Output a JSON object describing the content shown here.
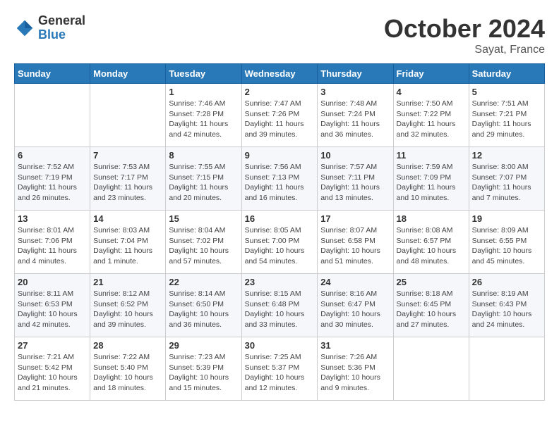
{
  "logo": {
    "general": "General",
    "blue": "Blue"
  },
  "title": "October 2024",
  "location": "Sayat, France",
  "weekdays": [
    "Sunday",
    "Monday",
    "Tuesday",
    "Wednesday",
    "Thursday",
    "Friday",
    "Saturday"
  ],
  "weeks": [
    [
      {
        "day": "",
        "sunrise": "",
        "sunset": "",
        "daylight": ""
      },
      {
        "day": "",
        "sunrise": "",
        "sunset": "",
        "daylight": ""
      },
      {
        "day": "1",
        "sunrise": "Sunrise: 7:46 AM",
        "sunset": "Sunset: 7:28 PM",
        "daylight": "Daylight: 11 hours and 42 minutes."
      },
      {
        "day": "2",
        "sunrise": "Sunrise: 7:47 AM",
        "sunset": "Sunset: 7:26 PM",
        "daylight": "Daylight: 11 hours and 39 minutes."
      },
      {
        "day": "3",
        "sunrise": "Sunrise: 7:48 AM",
        "sunset": "Sunset: 7:24 PM",
        "daylight": "Daylight: 11 hours and 36 minutes."
      },
      {
        "day": "4",
        "sunrise": "Sunrise: 7:50 AM",
        "sunset": "Sunset: 7:22 PM",
        "daylight": "Daylight: 11 hours and 32 minutes."
      },
      {
        "day": "5",
        "sunrise": "Sunrise: 7:51 AM",
        "sunset": "Sunset: 7:21 PM",
        "daylight": "Daylight: 11 hours and 29 minutes."
      }
    ],
    [
      {
        "day": "6",
        "sunrise": "Sunrise: 7:52 AM",
        "sunset": "Sunset: 7:19 PM",
        "daylight": "Daylight: 11 hours and 26 minutes."
      },
      {
        "day": "7",
        "sunrise": "Sunrise: 7:53 AM",
        "sunset": "Sunset: 7:17 PM",
        "daylight": "Daylight: 11 hours and 23 minutes."
      },
      {
        "day": "8",
        "sunrise": "Sunrise: 7:55 AM",
        "sunset": "Sunset: 7:15 PM",
        "daylight": "Daylight: 11 hours and 20 minutes."
      },
      {
        "day": "9",
        "sunrise": "Sunrise: 7:56 AM",
        "sunset": "Sunset: 7:13 PM",
        "daylight": "Daylight: 11 hours and 16 minutes."
      },
      {
        "day": "10",
        "sunrise": "Sunrise: 7:57 AM",
        "sunset": "Sunset: 7:11 PM",
        "daylight": "Daylight: 11 hours and 13 minutes."
      },
      {
        "day": "11",
        "sunrise": "Sunrise: 7:59 AM",
        "sunset": "Sunset: 7:09 PM",
        "daylight": "Daylight: 11 hours and 10 minutes."
      },
      {
        "day": "12",
        "sunrise": "Sunrise: 8:00 AM",
        "sunset": "Sunset: 7:07 PM",
        "daylight": "Daylight: 11 hours and 7 minutes."
      }
    ],
    [
      {
        "day": "13",
        "sunrise": "Sunrise: 8:01 AM",
        "sunset": "Sunset: 7:06 PM",
        "daylight": "Daylight: 11 hours and 4 minutes."
      },
      {
        "day": "14",
        "sunrise": "Sunrise: 8:03 AM",
        "sunset": "Sunset: 7:04 PM",
        "daylight": "Daylight: 11 hours and 1 minute."
      },
      {
        "day": "15",
        "sunrise": "Sunrise: 8:04 AM",
        "sunset": "Sunset: 7:02 PM",
        "daylight": "Daylight: 10 hours and 57 minutes."
      },
      {
        "day": "16",
        "sunrise": "Sunrise: 8:05 AM",
        "sunset": "Sunset: 7:00 PM",
        "daylight": "Daylight: 10 hours and 54 minutes."
      },
      {
        "day": "17",
        "sunrise": "Sunrise: 8:07 AM",
        "sunset": "Sunset: 6:58 PM",
        "daylight": "Daylight: 10 hours and 51 minutes."
      },
      {
        "day": "18",
        "sunrise": "Sunrise: 8:08 AM",
        "sunset": "Sunset: 6:57 PM",
        "daylight": "Daylight: 10 hours and 48 minutes."
      },
      {
        "day": "19",
        "sunrise": "Sunrise: 8:09 AM",
        "sunset": "Sunset: 6:55 PM",
        "daylight": "Daylight: 10 hours and 45 minutes."
      }
    ],
    [
      {
        "day": "20",
        "sunrise": "Sunrise: 8:11 AM",
        "sunset": "Sunset: 6:53 PM",
        "daylight": "Daylight: 10 hours and 42 minutes."
      },
      {
        "day": "21",
        "sunrise": "Sunrise: 8:12 AM",
        "sunset": "Sunset: 6:52 PM",
        "daylight": "Daylight: 10 hours and 39 minutes."
      },
      {
        "day": "22",
        "sunrise": "Sunrise: 8:14 AM",
        "sunset": "Sunset: 6:50 PM",
        "daylight": "Daylight: 10 hours and 36 minutes."
      },
      {
        "day": "23",
        "sunrise": "Sunrise: 8:15 AM",
        "sunset": "Sunset: 6:48 PM",
        "daylight": "Daylight: 10 hours and 33 minutes."
      },
      {
        "day": "24",
        "sunrise": "Sunrise: 8:16 AM",
        "sunset": "Sunset: 6:47 PM",
        "daylight": "Daylight: 10 hours and 30 minutes."
      },
      {
        "day": "25",
        "sunrise": "Sunrise: 8:18 AM",
        "sunset": "Sunset: 6:45 PM",
        "daylight": "Daylight: 10 hours and 27 minutes."
      },
      {
        "day": "26",
        "sunrise": "Sunrise: 8:19 AM",
        "sunset": "Sunset: 6:43 PM",
        "daylight": "Daylight: 10 hours and 24 minutes."
      }
    ],
    [
      {
        "day": "27",
        "sunrise": "Sunrise: 7:21 AM",
        "sunset": "Sunset: 5:42 PM",
        "daylight": "Daylight: 10 hours and 21 minutes."
      },
      {
        "day": "28",
        "sunrise": "Sunrise: 7:22 AM",
        "sunset": "Sunset: 5:40 PM",
        "daylight": "Daylight: 10 hours and 18 minutes."
      },
      {
        "day": "29",
        "sunrise": "Sunrise: 7:23 AM",
        "sunset": "Sunset: 5:39 PM",
        "daylight": "Daylight: 10 hours and 15 minutes."
      },
      {
        "day": "30",
        "sunrise": "Sunrise: 7:25 AM",
        "sunset": "Sunset: 5:37 PM",
        "daylight": "Daylight: 10 hours and 12 minutes."
      },
      {
        "day": "31",
        "sunrise": "Sunrise: 7:26 AM",
        "sunset": "Sunset: 5:36 PM",
        "daylight": "Daylight: 10 hours and 9 minutes."
      },
      {
        "day": "",
        "sunrise": "",
        "sunset": "",
        "daylight": ""
      },
      {
        "day": "",
        "sunrise": "",
        "sunset": "",
        "daylight": ""
      }
    ]
  ]
}
